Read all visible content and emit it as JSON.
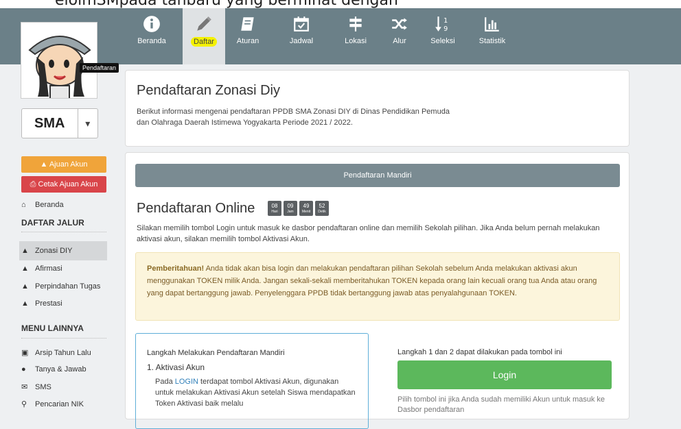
{
  "top_caption": "elolmSMpada tanbaru yang berminat dengan",
  "nav": [
    {
      "label": "Beranda",
      "icon": "info-icon"
    },
    {
      "label": "Daftar",
      "icon": "pencil-icon",
      "active": true
    },
    {
      "label": "Aturan",
      "icon": "book-icon"
    },
    {
      "label": "Jadwal",
      "icon": "calendar-check-icon"
    },
    {
      "label": "Lokasi",
      "icon": "signpost-icon"
    },
    {
      "label": "Alur",
      "icon": "shuffle-icon"
    },
    {
      "label": "Seleksi",
      "icon": "sort-numeric-icon"
    },
    {
      "label": "Statistik",
      "icon": "bar-chart-icon"
    }
  ],
  "tooltip": "Pendaftaran",
  "level_select": {
    "value": "SMA",
    "caret": "▾"
  },
  "sidebar": {
    "btn_ajuan": "Ajuan Akun",
    "btn_cetak": "Cetak Ajuan Akun",
    "beranda": "Beranda",
    "head_jalur": "DAFTAR JALUR",
    "jalur": [
      "Zonasi DIY",
      "Afirmasi",
      "Perpindahan Tugas",
      "Prestasi"
    ],
    "head_menu": "MENU LAINNYA",
    "menu": [
      "Arsip Tahun Lalu",
      "Tanya & Jawab",
      "SMS",
      "Pencarian NIK"
    ]
  },
  "main": {
    "title": "Pendaftaran Zonasi Diy",
    "desc": "Berikut informasi mengenai pendaftaran PPDB SMA Zonasi DIY di Dinas Pendidikan Pemuda dan Olahraga Daerah Istimewa Yogyakarta Periode 2021 / 2022.",
    "strip": "Pendaftaran Mandiri",
    "online_title": "Pendaftaran Online",
    "countdown": [
      {
        "n": "08",
        "u": "Hari"
      },
      {
        "n": "09",
        "u": "Jam"
      },
      {
        "n": "49",
        "u": "Menit"
      },
      {
        "n": "52",
        "u": "Detik"
      }
    ],
    "online_desc": "Silakan memilih tombol Login untuk masuk ke dasbor pendaftaran online dan memilih Sekolah pilihan. Jika Anda belum pernah melakukan aktivasi akun, silakan memilih tombol Aktivasi Akun.",
    "alert_strong": "Pemberitahuan!",
    "alert_text": " Anda tidak akan bisa login dan melakukan pendaftaran pilihan Sekolah sebelum Anda melakukan aktivasi akun menggunakan TOKEN milik Anda. Jangan sekali-sekali memberitahukan TOKEN kepada orang lain kecuali orang tua Anda atau orang yang dapat bertanggung jawab. Penyelenggara PPDB tidak bertanggung jawab atas penyalahgunaan TOKEN.",
    "steps_title": "Langkah Melakukan Pendaftaran Mandiri",
    "step1": "1. Aktivasi Akun",
    "step1_pre": "Pada ",
    "step1_link": "LOGIN",
    "step1_post": " terdapat tombol Aktivasi Akun, digunakan untuk melakukan Aktivasi Akun setelah Siswa mendapatkan Token Aktivasi baik melalu",
    "right_title": "Langkah 1 dan 2 dapat dilakukan pada tombol ini",
    "login": "Login",
    "right_note": "Pilih tombol ini jika Anda sudah memiliki Akun untuk masuk ke Dasbor pendaftaran"
  },
  "colors": {
    "navbar": "#6b8088",
    "active_tab": "#dfe2e4",
    "highlight": "#f4f100",
    "login": "#5cb85c",
    "orange": "#f0a43a",
    "red": "#d9454a"
  }
}
